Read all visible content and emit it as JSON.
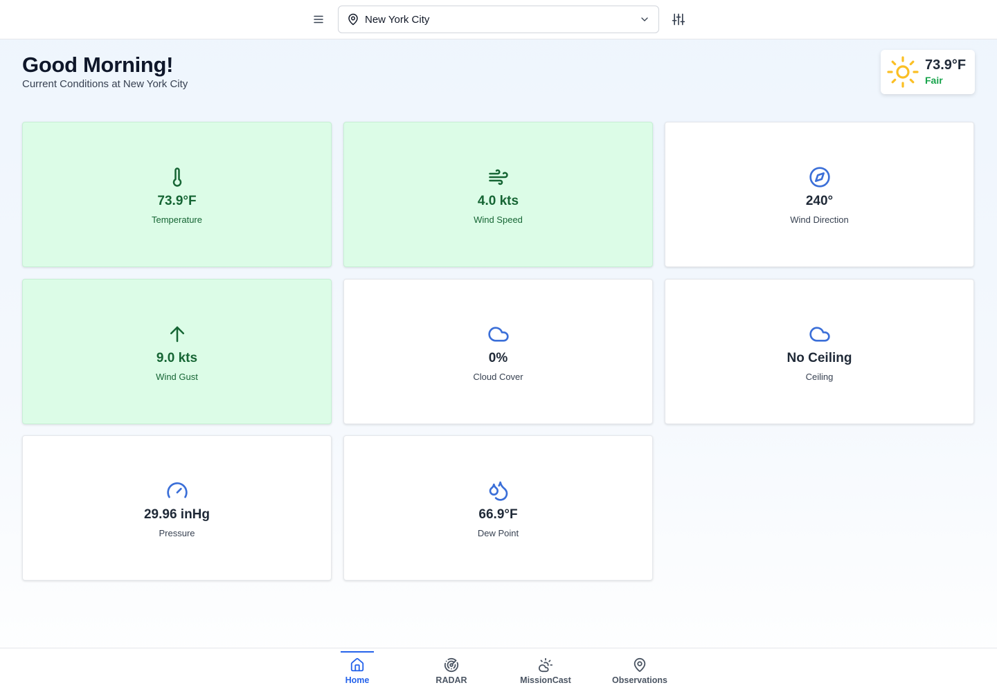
{
  "topbar": {
    "menu_icon": "menu-icon",
    "location": "New York City",
    "settings_icon": "sliders-icon"
  },
  "header": {
    "greeting": "Good Morning!",
    "subtitle": "Current Conditions at New York City"
  },
  "current": {
    "temp": "73.9°F",
    "condition": "Fair",
    "icon": "sun-icon",
    "condition_color": "#16a34a",
    "sun_color": "#fbbf24"
  },
  "metrics": [
    {
      "value": "73.9°F",
      "label": "Temperature",
      "icon": "thermometer-icon",
      "status": "good"
    },
    {
      "value": "4.0 kts",
      "label": "Wind Speed",
      "icon": "wind-icon",
      "status": "good"
    },
    {
      "value": "240°",
      "label": "Wind Direction",
      "icon": "compass-icon",
      "status": "neutral"
    },
    {
      "value": "9.0 kts",
      "label": "Wind Gust",
      "icon": "arrow-up-icon",
      "status": "good"
    },
    {
      "value": "0%",
      "label": "Cloud Cover",
      "icon": "cloud-icon",
      "status": "neutral"
    },
    {
      "value": "No Ceiling",
      "label": "Ceiling",
      "icon": "cloud-icon",
      "status": "neutral"
    },
    {
      "value": "29.96 inHg",
      "label": "Pressure",
      "icon": "gauge-icon",
      "status": "neutral"
    },
    {
      "value": "66.9°F",
      "label": "Dew Point",
      "icon": "droplets-icon",
      "status": "neutral"
    }
  ],
  "colors": {
    "good_bg": "#dcfce7",
    "good_text": "#166534",
    "accent": "#2563eb",
    "neutral_icon": "#3b6fd8"
  },
  "nav": [
    {
      "label": "Home",
      "icon": "home-icon",
      "active": true
    },
    {
      "label": "RADAR",
      "icon": "radar-icon",
      "active": false
    },
    {
      "label": "MissionCast",
      "icon": "cloud-sun-icon",
      "active": false
    },
    {
      "label": "Observations",
      "icon": "map-pin-icon",
      "active": false
    }
  ]
}
